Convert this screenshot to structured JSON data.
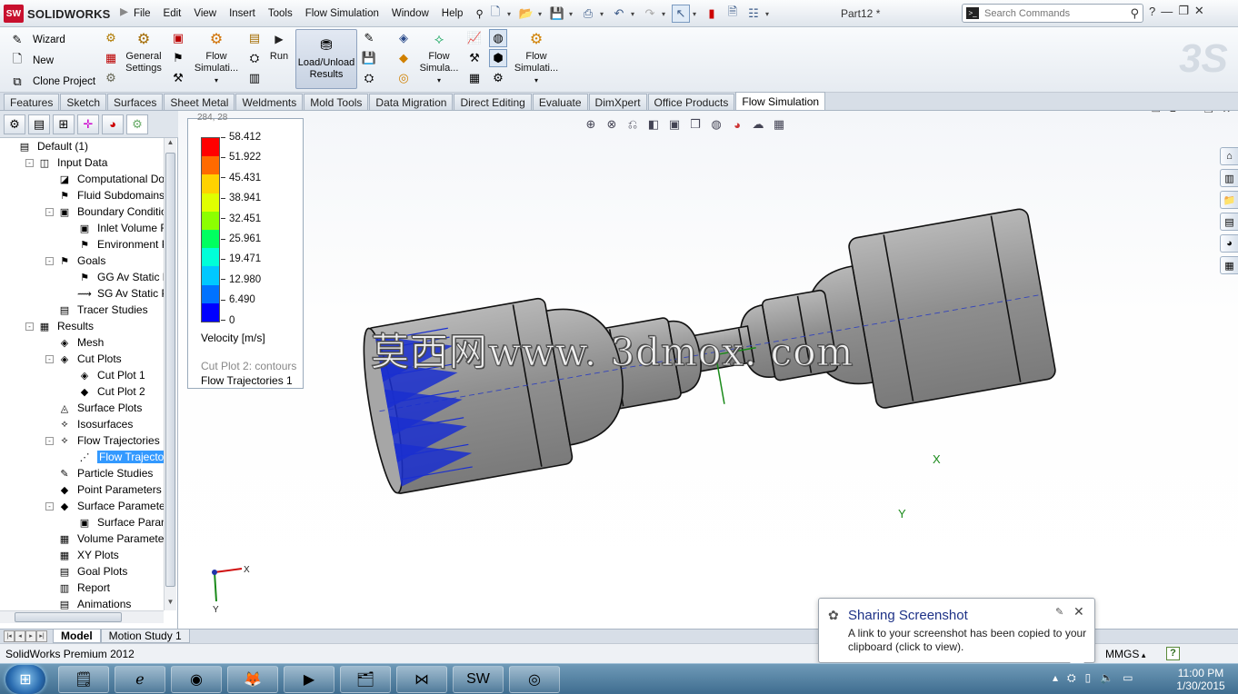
{
  "app": {
    "brand": "SOLIDWORKS",
    "brand_badge": "SW",
    "document_title": "Part12 *",
    "menus": [
      "File",
      "Edit",
      "View",
      "Insert",
      "Tools",
      "Flow Simulation",
      "Window",
      "Help"
    ],
    "search_placeholder": "Search Commands",
    "window_controls": [
      "?",
      "—",
      "❐",
      "✕"
    ]
  },
  "command_manager": {
    "wizard": "Wizard",
    "new": "New",
    "clone_project": "Clone Project",
    "general_settings": "General\nSettings",
    "flow_simulation_1": "Flow\nSimulati...",
    "run": "Run",
    "load_unload": "Load/Unload\nResults",
    "flow_simulation_2": "Flow\nSimula...",
    "flow_simulation_3": "Flow\nSimulati..."
  },
  "tabs": [
    {
      "label": "Features",
      "active": false
    },
    {
      "label": "Sketch",
      "active": false
    },
    {
      "label": "Surfaces",
      "active": false
    },
    {
      "label": "Sheet Metal",
      "active": false
    },
    {
      "label": "Weldments",
      "active": false
    },
    {
      "label": "Mold Tools",
      "active": false
    },
    {
      "label": "Data Migration",
      "active": false
    },
    {
      "label": "Direct Editing",
      "active": false
    },
    {
      "label": "Evaluate",
      "active": false
    },
    {
      "label": "DimXpert",
      "active": false
    },
    {
      "label": "Office Products",
      "active": false
    },
    {
      "label": "Flow Simulation",
      "active": true
    }
  ],
  "tree": {
    "root": "Default (1)",
    "items": [
      {
        "label": "Input Data",
        "level": 1,
        "exp": "-"
      },
      {
        "label": "Computational Don",
        "level": 2,
        "exp": ""
      },
      {
        "label": "Fluid Subdomains",
        "level": 2,
        "exp": ""
      },
      {
        "label": "Boundary Condition",
        "level": 2,
        "exp": "-"
      },
      {
        "label": "Inlet Volume Flo",
        "level": 3,
        "exp": ""
      },
      {
        "label": "Environment Pr",
        "level": 3,
        "exp": ""
      },
      {
        "label": "Goals",
        "level": 2,
        "exp": "-"
      },
      {
        "label": "GG Av Static Pre",
        "level": 3,
        "exp": ""
      },
      {
        "label": "SG Av Static Pre",
        "level": 3,
        "exp": ""
      },
      {
        "label": "Tracer Studies",
        "level": 2,
        "exp": ""
      },
      {
        "label": "Results",
        "level": 1,
        "exp": "-"
      },
      {
        "label": "Mesh",
        "level": 2,
        "exp": ""
      },
      {
        "label": "Cut Plots",
        "level": 2,
        "exp": "-"
      },
      {
        "label": "Cut Plot 1",
        "level": 3,
        "exp": ""
      },
      {
        "label": "Cut Plot 2",
        "level": 3,
        "exp": ""
      },
      {
        "label": "Surface Plots",
        "level": 2,
        "exp": ""
      },
      {
        "label": "Isosurfaces",
        "level": 2,
        "exp": ""
      },
      {
        "label": "Flow Trajectories",
        "level": 2,
        "exp": "-"
      },
      {
        "label": "Flow Trajectorie",
        "level": 3,
        "exp": "",
        "selected": true
      },
      {
        "label": "Particle Studies",
        "level": 2,
        "exp": ""
      },
      {
        "label": "Point Parameters",
        "level": 2,
        "exp": ""
      },
      {
        "label": "Surface Parameters",
        "level": 2,
        "exp": "-"
      },
      {
        "label": "Surface Parame",
        "level": 3,
        "exp": ""
      },
      {
        "label": "Volume Parameters",
        "level": 2,
        "exp": ""
      },
      {
        "label": "XY Plots",
        "level": 2,
        "exp": ""
      },
      {
        "label": "Goal Plots",
        "level": 2,
        "exp": ""
      },
      {
        "label": "Report",
        "level": 2,
        "exp": ""
      },
      {
        "label": "Animations",
        "level": 2,
        "exp": ""
      }
    ]
  },
  "legend": {
    "coord": "284, 28",
    "ticks": [
      "58.412",
      "51.922",
      "45.431",
      "38.941",
      "32.451",
      "25.961",
      "19.471",
      "12.980",
      "6.490",
      "0"
    ],
    "colors": [
      "#ff0000",
      "#ff6a00",
      "#ffd200",
      "#e0ff00",
      "#8cff00",
      "#00ff60",
      "#00ffd8",
      "#00c8ff",
      "#0072ff",
      "#0000ff"
    ],
    "quantity": "Velocity [m/s]",
    "plot_name": "Cut Plot 2: contours",
    "trajectory_name": "Flow Trajectories 1"
  },
  "viewport": {
    "watermark": "莫西网www. 3dmox. com",
    "axis_x": "X",
    "axis_y": "Y",
    "triad_x": "X",
    "triad_y": "Y"
  },
  "bottom_tabs": [
    {
      "label": "Model",
      "active": true
    },
    {
      "label": "Motion Study 1",
      "active": false
    }
  ],
  "status": {
    "product": "SolidWorks Premium 2012",
    "units": "MMGS",
    "help": "?"
  },
  "notification": {
    "title": "Sharing Screenshot",
    "body": "A link to your screenshot has been copied to your clipboard (click to view)."
  },
  "taskbar": {
    "time": "11:00 PM",
    "date": "1/30/2015"
  }
}
